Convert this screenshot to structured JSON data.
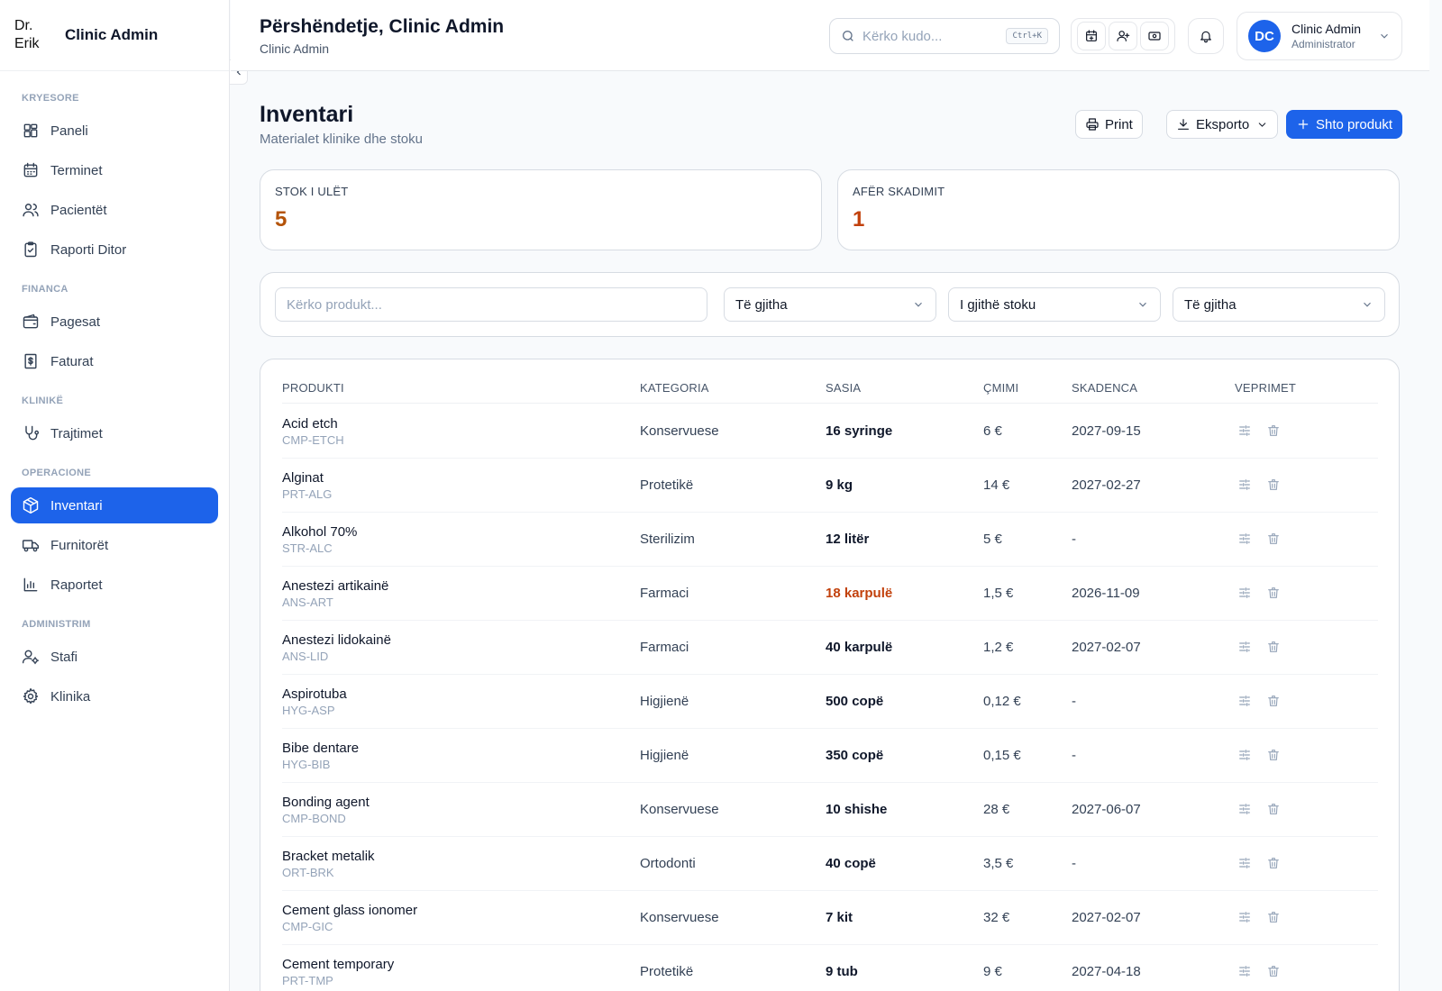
{
  "brand": {
    "logo_alt": "Dr. Erik",
    "name": "Clinic Admin"
  },
  "sidebar": {
    "sections": [
      {
        "title": "KRYESORE",
        "items": [
          {
            "label": "Paneli",
            "icon": "dashboard-icon"
          },
          {
            "label": "Terminet",
            "icon": "calendar-icon"
          },
          {
            "label": "Pacientët",
            "icon": "users-icon"
          },
          {
            "label": "Raporti Ditor",
            "icon": "clipboard-icon"
          }
        ]
      },
      {
        "title": "FINANCA",
        "items": [
          {
            "label": "Pagesat",
            "icon": "wallet-icon"
          },
          {
            "label": "Faturat",
            "icon": "invoice-icon"
          }
        ]
      },
      {
        "title": "KLINIKË",
        "items": [
          {
            "label": "Trajtimet",
            "icon": "stethoscope-icon"
          }
        ]
      },
      {
        "title": "OPERACIONE",
        "items": [
          {
            "label": "Inventari",
            "icon": "package-icon",
            "active": true
          },
          {
            "label": "Furnitorët",
            "icon": "truck-icon"
          },
          {
            "label": "Raportet",
            "icon": "chart-icon"
          }
        ]
      },
      {
        "title": "ADMINISTRIM",
        "items": [
          {
            "label": "Stafi",
            "icon": "user-cog-icon"
          },
          {
            "label": "Klinika",
            "icon": "gear-icon"
          }
        ]
      }
    ]
  },
  "header": {
    "greeting": "Përshëndetje, Clinic Admin",
    "subtitle": "Clinic Admin",
    "search_placeholder": "Kërko kudo...",
    "search_shortcut": "Ctrl+K",
    "user": {
      "initials": "DC",
      "name": "Clinic Admin",
      "role": "Administrator"
    }
  },
  "page": {
    "title": "Inventari",
    "subtitle": "Materialet klinike dhe stoku",
    "buttons": {
      "print": "Print",
      "export": "Eksporto",
      "add": "Shto produkt"
    }
  },
  "stats": {
    "low_stock": {
      "label": "STOK I ULËT",
      "value": "5"
    },
    "near_expiry": {
      "label": "AFËR SKADIMIT",
      "value": "1"
    }
  },
  "filters": {
    "search_placeholder": "Kërko produkt...",
    "category": "Të gjitha",
    "stock": "I gjithë stoku",
    "other": "Të gjitha"
  },
  "table": {
    "headers": {
      "product": "PRODUKTI",
      "category": "KATEGORIA",
      "qty": "SASIA",
      "price": "ÇMIMI",
      "expiry": "SKADENCA",
      "actions": "VEPRIMET"
    },
    "rows": [
      {
        "name": "Acid etch",
        "code": "CMP-ETCH",
        "category": "Konservuese",
        "qty": "16 syringe",
        "price": "6 €",
        "expiry": "2027-09-15",
        "warn": false
      },
      {
        "name": "Alginat",
        "code": "PRT-ALG",
        "category": "Protetikë",
        "qty": "9 kg",
        "price": "14 €",
        "expiry": "2027-02-27",
        "warn": false
      },
      {
        "name": "Alkohol 70%",
        "code": "STR-ALC",
        "category": "Sterilizim",
        "qty": "12 litër",
        "price": "5 €",
        "expiry": "-",
        "warn": false
      },
      {
        "name": "Anestezi artikainë",
        "code": "ANS-ART",
        "category": "Farmaci",
        "qty": "18 karpulë",
        "price": "1,5 €",
        "expiry": "2026-11-09",
        "warn": true
      },
      {
        "name": "Anestezi lidokainë",
        "code": "ANS-LID",
        "category": "Farmaci",
        "qty": "40 karpulë",
        "price": "1,2 €",
        "expiry": "2027-02-07",
        "warn": false
      },
      {
        "name": "Aspirotuba",
        "code": "HYG-ASP",
        "category": "Higjienë",
        "qty": "500 copë",
        "price": "0,12 €",
        "expiry": "-",
        "warn": false
      },
      {
        "name": "Bibe dentare",
        "code": "HYG-BIB",
        "category": "Higjienë",
        "qty": "350 copë",
        "price": "0,15 €",
        "expiry": "-",
        "warn": false
      },
      {
        "name": "Bonding agent",
        "code": "CMP-BOND",
        "category": "Konservuese",
        "qty": "10 shishe",
        "price": "28 €",
        "expiry": "2027-06-07",
        "warn": false
      },
      {
        "name": "Bracket metalik",
        "code": "ORT-BRK",
        "category": "Ortodonti",
        "qty": "40 copë",
        "price": "3,5 €",
        "expiry": "-",
        "warn": false
      },
      {
        "name": "Cement glass ionomer",
        "code": "CMP-GIC",
        "category": "Konservuese",
        "qty": "7 kit",
        "price": "32 €",
        "expiry": "2027-02-07",
        "warn": false
      },
      {
        "name": "Cement temporary",
        "code": "PRT-TMP",
        "category": "Protetikë",
        "qty": "9 tub",
        "price": "9 €",
        "expiry": "2027-04-18",
        "warn": false
      }
    ]
  }
}
